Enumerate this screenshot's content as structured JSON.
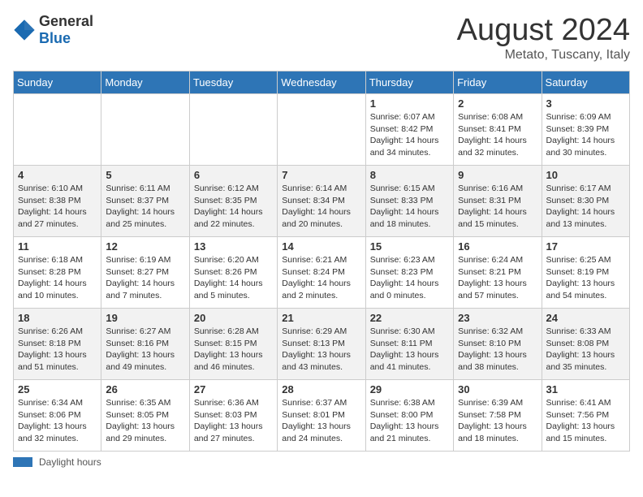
{
  "header": {
    "logo_general": "General",
    "logo_blue": "Blue",
    "month_title": "August 2024",
    "location": "Metato, Tuscany, Italy"
  },
  "days_of_week": [
    "Sunday",
    "Monday",
    "Tuesday",
    "Wednesday",
    "Thursday",
    "Friday",
    "Saturday"
  ],
  "footer": {
    "daylight_label": "Daylight hours"
  },
  "weeks": [
    [
      {
        "day": "",
        "info": ""
      },
      {
        "day": "",
        "info": ""
      },
      {
        "day": "",
        "info": ""
      },
      {
        "day": "",
        "info": ""
      },
      {
        "day": "1",
        "info": "Sunrise: 6:07 AM\nSunset: 8:42 PM\nDaylight: 14 hours and 34 minutes."
      },
      {
        "day": "2",
        "info": "Sunrise: 6:08 AM\nSunset: 8:41 PM\nDaylight: 14 hours and 32 minutes."
      },
      {
        "day": "3",
        "info": "Sunrise: 6:09 AM\nSunset: 8:39 PM\nDaylight: 14 hours and 30 minutes."
      }
    ],
    [
      {
        "day": "4",
        "info": "Sunrise: 6:10 AM\nSunset: 8:38 PM\nDaylight: 14 hours and 27 minutes."
      },
      {
        "day": "5",
        "info": "Sunrise: 6:11 AM\nSunset: 8:37 PM\nDaylight: 14 hours and 25 minutes."
      },
      {
        "day": "6",
        "info": "Sunrise: 6:12 AM\nSunset: 8:35 PM\nDaylight: 14 hours and 22 minutes."
      },
      {
        "day": "7",
        "info": "Sunrise: 6:14 AM\nSunset: 8:34 PM\nDaylight: 14 hours and 20 minutes."
      },
      {
        "day": "8",
        "info": "Sunrise: 6:15 AM\nSunset: 8:33 PM\nDaylight: 14 hours and 18 minutes."
      },
      {
        "day": "9",
        "info": "Sunrise: 6:16 AM\nSunset: 8:31 PM\nDaylight: 14 hours and 15 minutes."
      },
      {
        "day": "10",
        "info": "Sunrise: 6:17 AM\nSunset: 8:30 PM\nDaylight: 14 hours and 13 minutes."
      }
    ],
    [
      {
        "day": "11",
        "info": "Sunrise: 6:18 AM\nSunset: 8:28 PM\nDaylight: 14 hours and 10 minutes."
      },
      {
        "day": "12",
        "info": "Sunrise: 6:19 AM\nSunset: 8:27 PM\nDaylight: 14 hours and 7 minutes."
      },
      {
        "day": "13",
        "info": "Sunrise: 6:20 AM\nSunset: 8:26 PM\nDaylight: 14 hours and 5 minutes."
      },
      {
        "day": "14",
        "info": "Sunrise: 6:21 AM\nSunset: 8:24 PM\nDaylight: 14 hours and 2 minutes."
      },
      {
        "day": "15",
        "info": "Sunrise: 6:23 AM\nSunset: 8:23 PM\nDaylight: 14 hours and 0 minutes."
      },
      {
        "day": "16",
        "info": "Sunrise: 6:24 AM\nSunset: 8:21 PM\nDaylight: 13 hours and 57 minutes."
      },
      {
        "day": "17",
        "info": "Sunrise: 6:25 AM\nSunset: 8:19 PM\nDaylight: 13 hours and 54 minutes."
      }
    ],
    [
      {
        "day": "18",
        "info": "Sunrise: 6:26 AM\nSunset: 8:18 PM\nDaylight: 13 hours and 51 minutes."
      },
      {
        "day": "19",
        "info": "Sunrise: 6:27 AM\nSunset: 8:16 PM\nDaylight: 13 hours and 49 minutes."
      },
      {
        "day": "20",
        "info": "Sunrise: 6:28 AM\nSunset: 8:15 PM\nDaylight: 13 hours and 46 minutes."
      },
      {
        "day": "21",
        "info": "Sunrise: 6:29 AM\nSunset: 8:13 PM\nDaylight: 13 hours and 43 minutes."
      },
      {
        "day": "22",
        "info": "Sunrise: 6:30 AM\nSunset: 8:11 PM\nDaylight: 13 hours and 41 minutes."
      },
      {
        "day": "23",
        "info": "Sunrise: 6:32 AM\nSunset: 8:10 PM\nDaylight: 13 hours and 38 minutes."
      },
      {
        "day": "24",
        "info": "Sunrise: 6:33 AM\nSunset: 8:08 PM\nDaylight: 13 hours and 35 minutes."
      }
    ],
    [
      {
        "day": "25",
        "info": "Sunrise: 6:34 AM\nSunset: 8:06 PM\nDaylight: 13 hours and 32 minutes."
      },
      {
        "day": "26",
        "info": "Sunrise: 6:35 AM\nSunset: 8:05 PM\nDaylight: 13 hours and 29 minutes."
      },
      {
        "day": "27",
        "info": "Sunrise: 6:36 AM\nSunset: 8:03 PM\nDaylight: 13 hours and 27 minutes."
      },
      {
        "day": "28",
        "info": "Sunrise: 6:37 AM\nSunset: 8:01 PM\nDaylight: 13 hours and 24 minutes."
      },
      {
        "day": "29",
        "info": "Sunrise: 6:38 AM\nSunset: 8:00 PM\nDaylight: 13 hours and 21 minutes."
      },
      {
        "day": "30",
        "info": "Sunrise: 6:39 AM\nSunset: 7:58 PM\nDaylight: 13 hours and 18 minutes."
      },
      {
        "day": "31",
        "info": "Sunrise: 6:41 AM\nSunset: 7:56 PM\nDaylight: 13 hours and 15 minutes."
      }
    ]
  ]
}
